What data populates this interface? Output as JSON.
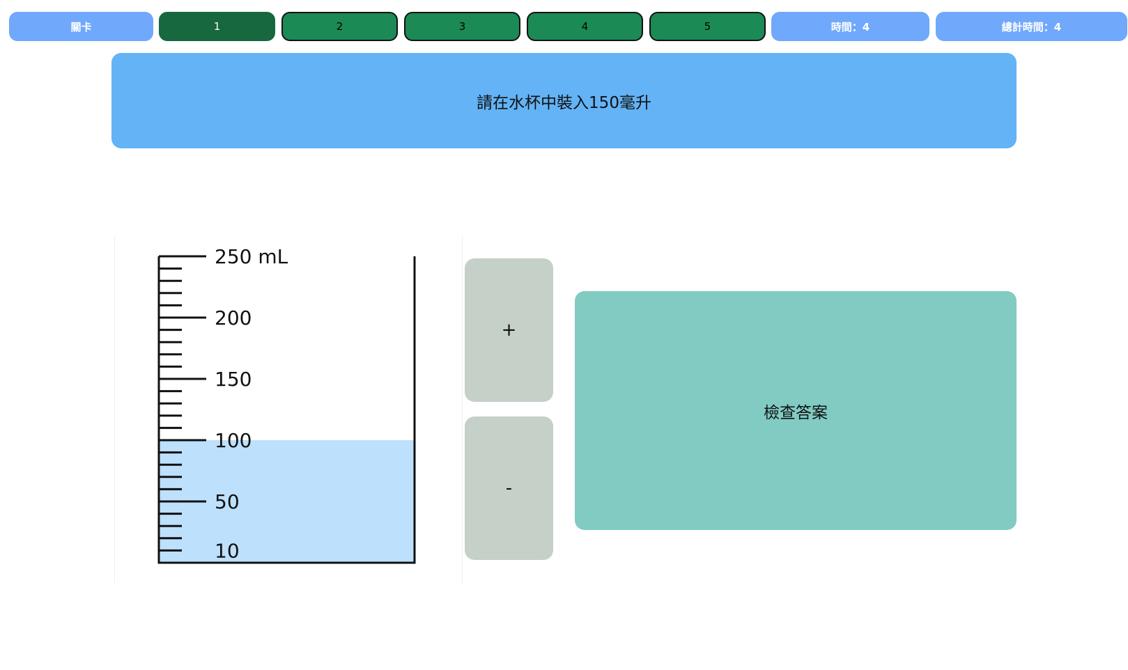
{
  "topbar": {
    "level_label": "關卡",
    "levels": [
      "1",
      "2",
      "3",
      "4",
      "5"
    ],
    "active_level_index": 0,
    "time_label": "時間：4",
    "total_time_label": "總計時間：4"
  },
  "task": {
    "instruction": "請在水杯中裝入150毫升"
  },
  "beaker": {
    "max_ml": 250,
    "water_ml": 100,
    "scale_labels": [
      {
        "value": 250,
        "text": "250 mL"
      },
      {
        "value": 200,
        "text": "200"
      },
      {
        "value": 150,
        "text": "150"
      },
      {
        "value": 100,
        "text": "100"
      },
      {
        "value": 50,
        "text": "50"
      },
      {
        "value": 10,
        "text": "10"
      }
    ],
    "water_color": "#bde0fc"
  },
  "controls": {
    "plus_label": "+",
    "minus_label": "-",
    "check_label": "檢查答案"
  },
  "colors": {
    "level_green": "#1b8a55",
    "banner_blue": "#63b3f6",
    "pill_blue": "#70a8fb",
    "check_teal": "#81cbc3",
    "control_gray": "#c5d0c8"
  }
}
